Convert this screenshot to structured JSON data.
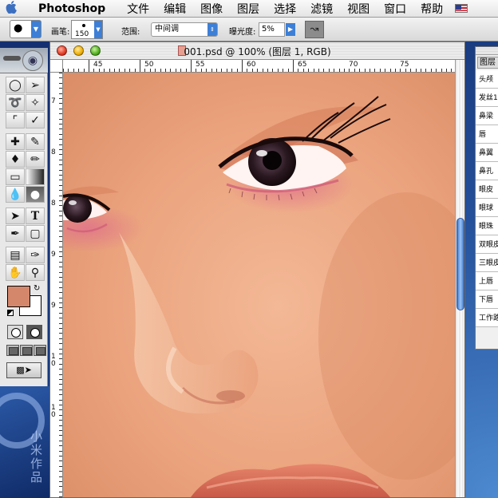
{
  "menubar": {
    "apple": "",
    "app_name": "Photoshop",
    "items": [
      "文件",
      "编辑",
      "图像",
      "图层",
      "选择",
      "滤镜",
      "视图",
      "窗口",
      "帮助"
    ]
  },
  "options": {
    "brush_label": "画笔:",
    "brush_size": "150",
    "range_label": "范围:",
    "range_value": "中间调",
    "exposure_label": "曝光度:",
    "exposure_value": "5%"
  },
  "toolbox": {
    "icons": [
      "marquee-icon",
      "move-icon",
      "lasso-icon",
      "magic-wand-icon",
      "crop-icon",
      "slice-icon",
      "healing-brush-icon",
      "brush-icon",
      "clone-stamp-icon",
      "history-brush-icon",
      "eraser-icon",
      "gradient-icon",
      "blur-icon",
      "burn-icon",
      "path-select-icon",
      "type-icon",
      "pen-icon",
      "shape-icon",
      "notes-icon",
      "eyedropper-icon",
      "hand-icon",
      "zoom-icon"
    ],
    "foreground_color": "#d5876b",
    "background_color": "#ffffff",
    "active_tool": "burn-icon"
  },
  "document": {
    "title": "001.psd @ 100% (图层 1, RGB)",
    "ruler_top_labels": [
      "45",
      "50",
      "55",
      "60",
      "65",
      "70",
      "75"
    ],
    "ruler_left_labels": [
      "7",
      "8",
      "8",
      "9",
      "9",
      "10",
      "10"
    ]
  },
  "wallpaper": {
    "text": "小米作品"
  },
  "layers": {
    "tab": "图层",
    "items": [
      "头颅",
      "发丝1",
      "鼻梁",
      "唇",
      "鼻翼",
      "鼻孔",
      "眼皮",
      "眼球",
      "眼珠",
      "双眼皮",
      "三眼皮",
      "上唇",
      "下唇",
      "工作路"
    ]
  },
  "colors": {
    "skin": "#eba47e",
    "accent": "#3d7fd6"
  }
}
